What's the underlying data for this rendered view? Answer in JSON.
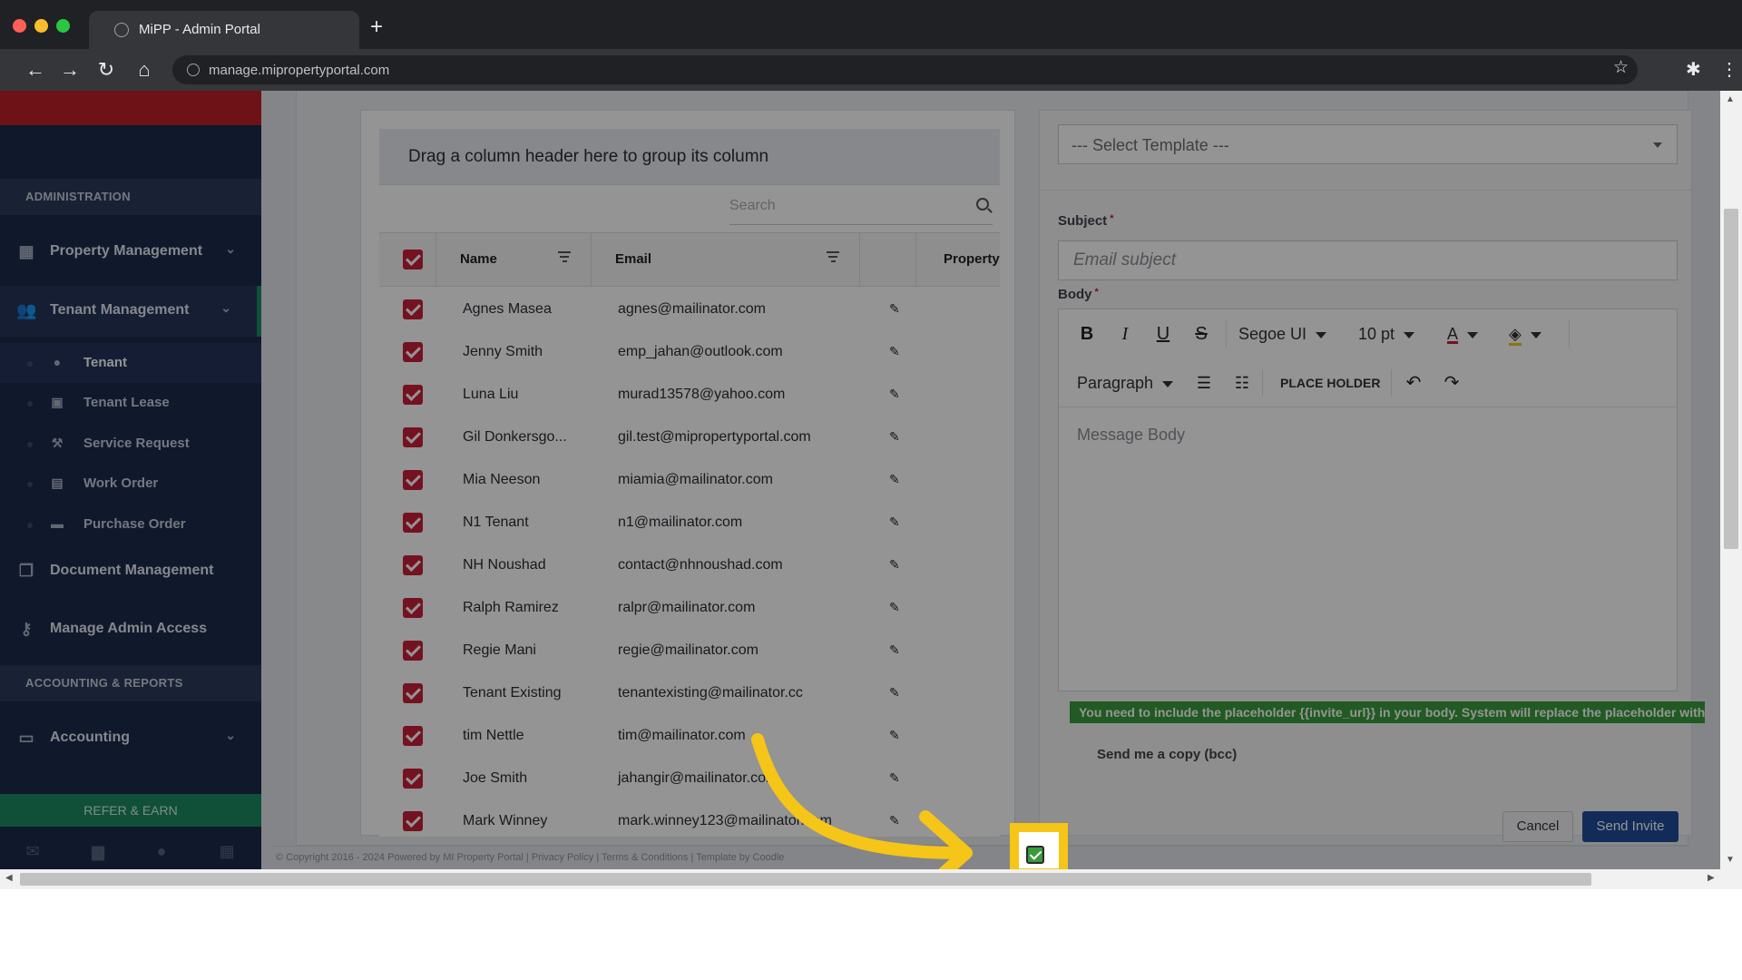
{
  "browser": {
    "tab_title": "MiPP - Admin Portal",
    "new_tab": "+",
    "url": "manage.mipropertyportal.com"
  },
  "sidebar": {
    "section_admin": "ADMINISTRATION",
    "section_accounting": "ACCOUNTING & REPORTS",
    "items": [
      {
        "label": "Property Management",
        "icon": "building-icon"
      },
      {
        "label": "Tenant Management",
        "icon": "users-icon"
      },
      {
        "label": "Document Management",
        "icon": "documents-icon"
      },
      {
        "label": "Manage Admin Access",
        "icon": "key-icon"
      },
      {
        "label": "Accounting",
        "icon": "money-icon"
      }
    ],
    "sub_items": [
      {
        "label": "Tenant",
        "icon": "user-icon"
      },
      {
        "label": "Tenant Lease",
        "icon": "calendar-icon"
      },
      {
        "label": "Service Request",
        "icon": "wrench-icon"
      },
      {
        "label": "Work Order",
        "icon": "clipboard-icon"
      },
      {
        "label": "Purchase Order",
        "icon": "truck-icon"
      }
    ],
    "refer_label": "REFER & EARN"
  },
  "grid": {
    "group_hint": "Drag a column header here to group its column",
    "search_placeholder": "Search",
    "columns": {
      "name": "Name",
      "email": "Email",
      "property": "Property"
    },
    "rows": [
      {
        "name": "Agnes Masea",
        "email": "agnes@mailinator.com"
      },
      {
        "name": "Jenny Smith",
        "email": "emp_jahan@outlook.com"
      },
      {
        "name": "Luna Liu",
        "email": "murad13578@yahoo.com"
      },
      {
        "name": "Gil Donkersgo...",
        "email": "gil.test@mipropertyportal.com"
      },
      {
        "name": "Mia Neeson",
        "email": "miamia@mailinator.com"
      },
      {
        "name": "N1 Tenant",
        "email": "n1@mailinator.com"
      },
      {
        "name": "NH Noushad",
        "email": "contact@nhnoushad.com"
      },
      {
        "name": "Ralph Ramirez",
        "email": "ralpr@mailinator.com"
      },
      {
        "name": "Regie Mani",
        "email": "regie@mailinator.com"
      },
      {
        "name": "Tenant Existing",
        "email": "tenantexisting@mailinator.cc"
      },
      {
        "name": "tim Nettle",
        "email": "tim@mailinator.com"
      },
      {
        "name": "Joe Smith",
        "email": "jahangir@mailinator.com"
      },
      {
        "name": "Mark Winney",
        "email": "mark.winney123@mailinator.com"
      }
    ]
  },
  "compose": {
    "template_placeholder": "--- Select Template ---",
    "subject_label": "Subject",
    "subject_placeholder": "Email subject",
    "body_label": "Body",
    "required_mark": "*",
    "font_family": "Segoe UI",
    "font_size": "10 pt",
    "paragraph": "Paragraph",
    "placeholder_btn": "PLACE HOLDER",
    "body_placeholder": "Message Body",
    "notice": "You need to include the placeholder {{invite_url}} in your body. System will replace the placeholder with the",
    "bcc_label": "Send me a copy (bcc)",
    "cancel": "Cancel",
    "send": "Send Invite"
  },
  "footer": {
    "text": "© Copyright 2016 - 2024 Powered by MI Property Portal | Privacy Policy | Terms & Conditions | Template by Coodle"
  },
  "colors": {
    "accent_red": "#c8203c",
    "sidebar_bg": "#1d2a4c",
    "green": "#3a9b3c",
    "highlight": "#f5c518",
    "primary_blue": "#1f4d9a"
  }
}
